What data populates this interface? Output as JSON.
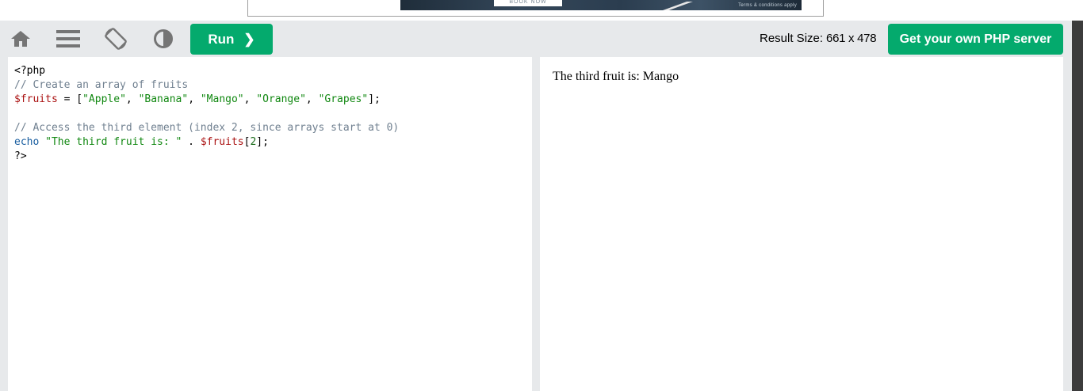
{
  "ad": {
    "book_label": "BOOK NOW",
    "terms": "Terms & conditions apply"
  },
  "toolbar": {
    "home_icon": "home-icon",
    "menu_icon": "menu-icon",
    "rotate_icon": "rotate-icon",
    "theme_icon": "contrast-icon",
    "run_label": "Run",
    "run_chevron": "❯",
    "result_size_label": "Result Size:",
    "result_size_value": "661 x 478",
    "php_server_label": "Get your own PHP server"
  },
  "code": {
    "line1": "<?php",
    "line2": "// Create an array of fruits",
    "line3_var": "$fruits",
    "line3_op": " = [",
    "line3_s1": "\"Apple\"",
    "line3_s2": "\"Banana\"",
    "line3_s3": "\"Mango\"",
    "line3_s4": "\"Orange\"",
    "line3_s5": "\"Grapes\"",
    "line3_end": "];",
    "line5": "// Access the third element (index 2, since arrays start at 0)",
    "line6_kw": "echo",
    "line6_str": "\"The third fruit is: \"",
    "line6_dot": " . ",
    "line6_var": "$fruits",
    "line6_idx_open": "[",
    "line6_num": "2",
    "line6_end": "];",
    "line7": "?>"
  },
  "result": {
    "output": "The third fruit is: Mango"
  },
  "colors": {
    "accent": "#04aa6d",
    "toolbar_bg": "#e7e9eb",
    "icon": "#757575"
  }
}
